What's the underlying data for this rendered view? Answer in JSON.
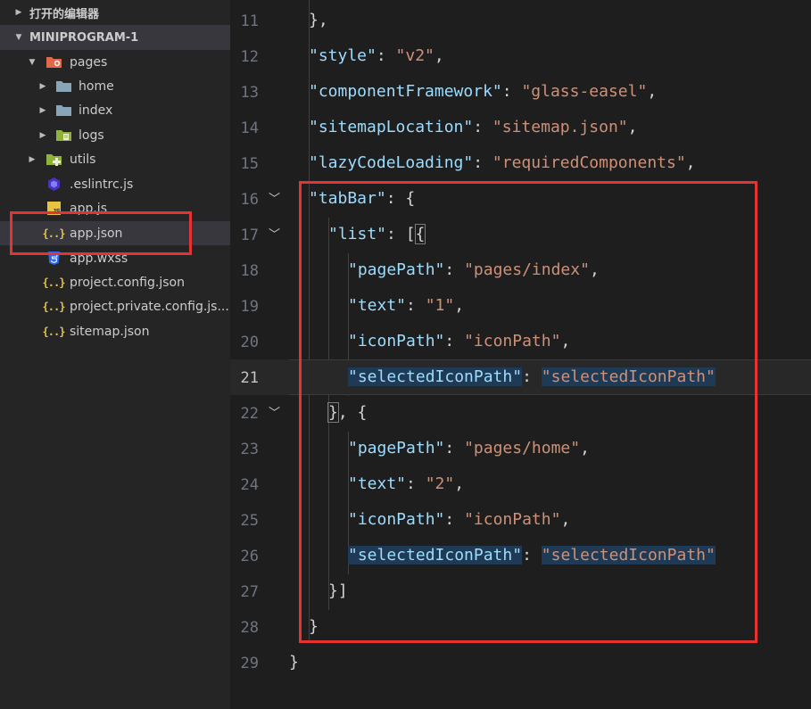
{
  "sidebar": {
    "open_editors_label": "打开的编辑器",
    "project_label": "MINIPROGRAM-1",
    "items": [
      {
        "label": "pages",
        "icon": "folder-open-icon"
      },
      {
        "label": "home",
        "icon": "folder-icon"
      },
      {
        "label": "index",
        "icon": "folder-icon"
      },
      {
        "label": "logs",
        "icon": "folder-icon"
      },
      {
        "label": "utils",
        "icon": "folder-icon"
      },
      {
        "label": ".eslintrc.js",
        "icon": "eslint-icon"
      },
      {
        "label": "app.js",
        "icon": "js-file-icon"
      },
      {
        "label": "app.json",
        "icon": "json-file-icon"
      },
      {
        "label": "app.wxss",
        "icon": "css-file-icon"
      },
      {
        "label": "project.config.json",
        "icon": "json-file-icon"
      },
      {
        "label": "project.private.config.js...",
        "icon": "json-file-icon"
      },
      {
        "label": "sitemap.json",
        "icon": "json-file-icon"
      }
    ],
    "selected_item": "app.json",
    "annotation_color": "#e53333"
  },
  "editor": {
    "current_line": 21,
    "lines": [
      {
        "n": "11"
      },
      {
        "n": "12"
      },
      {
        "n": "13"
      },
      {
        "n": "14"
      },
      {
        "n": "15"
      },
      {
        "n": "16"
      },
      {
        "n": "17"
      },
      {
        "n": "18"
      },
      {
        "n": "19"
      },
      {
        "n": "20"
      },
      {
        "n": "21"
      },
      {
        "n": "22"
      },
      {
        "n": "23"
      },
      {
        "n": "24"
      },
      {
        "n": "25"
      },
      {
        "n": "26"
      },
      {
        "n": "27"
      },
      {
        "n": "28"
      },
      {
        "n": "29"
      }
    ],
    "tokens": {
      "l11": "},",
      "style_k": "\"style\"",
      "style_v": "\"v2\"",
      "cf_k": "\"componentFramework\"",
      "cf_v": "\"glass-easel\"",
      "sm_k": "\"sitemapLocation\"",
      "sm_v": "\"sitemap.json\"",
      "lcl_k": "\"lazyCodeLoading\"",
      "lcl_v": "\"requiredComponents\"",
      "tabbar_k": "\"tabBar\"",
      "list_k": "\"list\"",
      "pp1_k": "\"pagePath\"",
      "pp1_v": "\"pages/index\"",
      "t1_k": "\"text\"",
      "t1_v": "\"1\"",
      "ip1_k": "\"iconPath\"",
      "ip1_v": "\"iconPath\"",
      "sip1_k": "\"selectedIconPath\"",
      "sip1_v": "\"selectedIconPath\"",
      "pp2_k": "\"pagePath\"",
      "pp2_v": "\"pages/home\"",
      "t2_k": "\"text\"",
      "t2_v": "\"2\"",
      "ip2_k": "\"iconPath\"",
      "ip2_v": "\"iconPath\"",
      "sip2_k": "\"selectedIconPath\"",
      "sip2_v": "\"selectedIconPath\""
    }
  }
}
